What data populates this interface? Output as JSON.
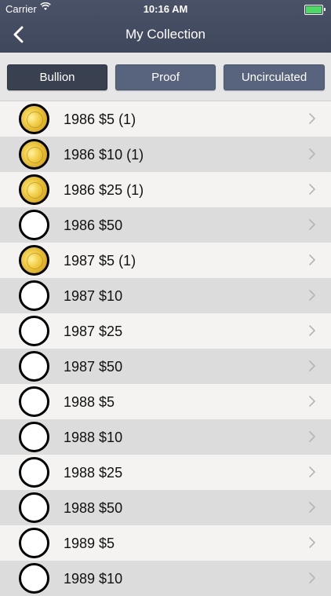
{
  "status": {
    "carrier": "Carrier",
    "time": "10:16 AM"
  },
  "nav": {
    "title": "My Collection",
    "back_icon": "chevron-left-icon"
  },
  "segments": [
    {
      "label": "Bullion",
      "selected": true
    },
    {
      "label": "Proof",
      "selected": false
    },
    {
      "label": "Uncirculated",
      "selected": false
    }
  ],
  "rows": [
    {
      "label": "1986 $5 (1)",
      "owned": true
    },
    {
      "label": "1986 $10 (1)",
      "owned": true
    },
    {
      "label": "1986 $25 (1)",
      "owned": true
    },
    {
      "label": "1986 $50",
      "owned": false
    },
    {
      "label": "1987 $5 (1)",
      "owned": true
    },
    {
      "label": "1987 $10",
      "owned": false
    },
    {
      "label": "1987 $25",
      "owned": false
    },
    {
      "label": "1987 $50",
      "owned": false
    },
    {
      "label": "1988 $5",
      "owned": false
    },
    {
      "label": "1988 $10",
      "owned": false
    },
    {
      "label": "1988 $25",
      "owned": false
    },
    {
      "label": "1988 $50",
      "owned": false
    },
    {
      "label": "1989 $5",
      "owned": false
    },
    {
      "label": "1989 $10",
      "owned": false
    }
  ],
  "colors": {
    "nav_bg": "#434b60",
    "segment_selected": "#39404f",
    "segment_unselected": "#58647e",
    "row_light": "#f4f3f2",
    "row_dark": "#dcdcdc",
    "coin_gold": "#f2cf4a",
    "battery": "#4cd964"
  }
}
